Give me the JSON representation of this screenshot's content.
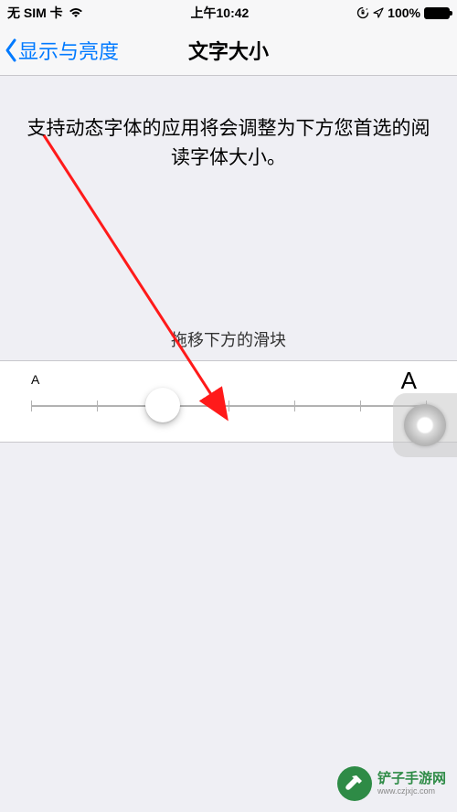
{
  "status": {
    "carrier": "无 SIM 卡",
    "time": "上午10:42",
    "battery_pct": "100%"
  },
  "nav": {
    "back_label": "显示与亮度",
    "title": "文字大小"
  },
  "body": {
    "description": "支持动态字体的应用将会调整为下方您首选的阅读字体大小。",
    "drag_hint": "拖移下方的滑块"
  },
  "slider": {
    "small_label": "A",
    "big_label": "A",
    "ticks": 7,
    "value_index": 2
  },
  "watermark": {
    "name": "铲子手游网",
    "url": "www.czjxjc.com"
  }
}
